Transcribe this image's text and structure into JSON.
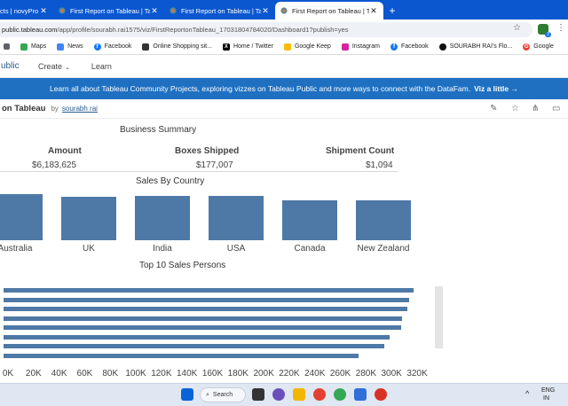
{
  "browser": {
    "tabs": [
      {
        "label": "cts | novyPro",
        "active": false
      },
      {
        "label": "First Report on Tableau | Table",
        "active": false
      },
      {
        "label": "First Report on Tableau | Table",
        "active": false
      },
      {
        "label": "First Report on Tableau | Table",
        "active": true
      }
    ],
    "url_host": "public.tableau.com",
    "url_path": "/app/profile/sourabh.rai1575/viz/FirstReportonTableau_17031804784020/Dashboard1?publish=yes",
    "extension_badge": "2",
    "bookmarks": [
      {
        "label": "Maps",
        "icon": "maps-icon",
        "color": "#34a853"
      },
      {
        "label": "News",
        "icon": "news-icon",
        "color": "#4285f4"
      },
      {
        "label": "Facebook",
        "icon": "facebook-icon",
        "color": "#1877f2"
      },
      {
        "label": "Online Shopping sit...",
        "icon": "shopping-icon",
        "color": "#333333"
      },
      {
        "label": "Home / Twitter",
        "icon": "x-icon",
        "color": "#000000"
      },
      {
        "label": "Google Keep",
        "icon": "keep-icon",
        "color": "#fbbc04"
      },
      {
        "label": "Instagram",
        "icon": "instagram-icon",
        "color": "#d6249f"
      },
      {
        "label": "Facebook",
        "icon": "facebook-icon",
        "color": "#1877f2"
      },
      {
        "label": "SOURABH RAI's Flo...",
        "icon": "flo-icon",
        "color": "#111111"
      },
      {
        "label": "Google",
        "icon": "google-icon",
        "color": "#ea4335"
      }
    ]
  },
  "tableau": {
    "brand": "ublic",
    "nav": [
      {
        "label": "Create",
        "has_dropdown": true
      },
      {
        "label": "Learn",
        "has_dropdown": false
      }
    ],
    "banner_text": "Learn all about Tableau Community Projects, exploring vizzes on Tableau Public and more ways to connect with the DataFam.",
    "banner_link": "Viz a little →",
    "viz_title": "on Tableau",
    "by": "by",
    "author": "sourabh rai"
  },
  "dashboard": {
    "summary_title": "Business Summary",
    "kpis": [
      {
        "header": "Amount",
        "value": "$6,183,625"
      },
      {
        "header": "Boxes Shipped",
        "value": "$177,007"
      },
      {
        "header": "Shipment Count",
        "value": "$1,094"
      }
    ],
    "country_title": "Sales By Country",
    "persons_title": "Top 10 Sales Persons"
  },
  "chart_data": [
    {
      "type": "bar",
      "title": "Sales By Country",
      "categories": [
        "Australia",
        "UK",
        "India",
        "USA",
        "Canada",
        "New Zealand"
      ],
      "relative_values": [
        1.0,
        0.95,
        0.96,
        0.96,
        0.87,
        0.86
      ]
    },
    {
      "type": "bar",
      "orientation": "horizontal",
      "title": "Top 10 Sales Persons",
      "x_ticks": [
        "0K",
        "20K",
        "40K",
        "60K",
        "80K",
        "100K",
        "120K",
        "140K",
        "160K",
        "180K",
        "200K",
        "220K",
        "240K",
        "260K",
        "280K",
        "300K",
        "320K"
      ],
      "xlim": [
        0,
        320000
      ],
      "values": [
        321000,
        317000,
        316000,
        312000,
        311000,
        302000,
        298000,
        278000
      ]
    }
  ],
  "taskbar": {
    "search_label": "Search",
    "lang": "ENG",
    "region": "IN"
  }
}
